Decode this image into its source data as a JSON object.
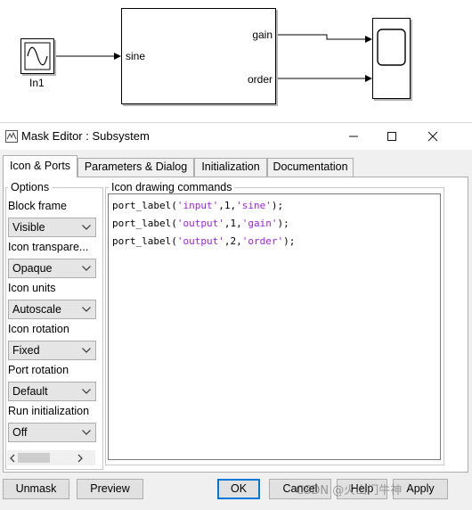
{
  "model": {
    "inport_label": "In1",
    "subsystem_input_port": "sine",
    "subsystem_output_ports": [
      "gain",
      "order"
    ]
  },
  "dialog": {
    "title": "Mask Editor : Subsystem",
    "tabs": [
      "Icon & Ports",
      "Parameters & Dialog",
      "Initialization",
      "Documentation"
    ],
    "options": {
      "legend": "Options",
      "items": [
        {
          "label": "Block frame",
          "value": "Visible"
        },
        {
          "label": "Icon transpare...",
          "value": "Opaque"
        },
        {
          "label": "Icon units",
          "value": "Autoscale"
        },
        {
          "label": "Icon rotation",
          "value": "Fixed"
        },
        {
          "label": "Port rotation",
          "value": "Default"
        },
        {
          "label": "Run initialization",
          "value": "Off"
        }
      ]
    },
    "icon_commands": {
      "legend": "Icon drawing commands",
      "lines": [
        {
          "fn": "port_label(",
          "a": "'input'",
          "b": ",1,",
          "c": "'sine'",
          "d": ");"
        },
        {
          "fn": "port_label(",
          "a": "'output'",
          "b": ",1,",
          "c": "'gain'",
          "d": ");"
        },
        {
          "fn": "port_label(",
          "a": "'output'",
          "b": ",2,",
          "c": "'order'",
          "d": ");"
        }
      ]
    },
    "buttons": {
      "unmask": "Unmask",
      "preview": "Preview",
      "ok": "OK",
      "cancel": "Cancel",
      "help": "Help",
      "apply": "Apply"
    },
    "watermark": "CSDN @火山门牛神"
  },
  "colors": {
    "string_literal": "#a020f0",
    "default_button_border": "#0078d7"
  }
}
